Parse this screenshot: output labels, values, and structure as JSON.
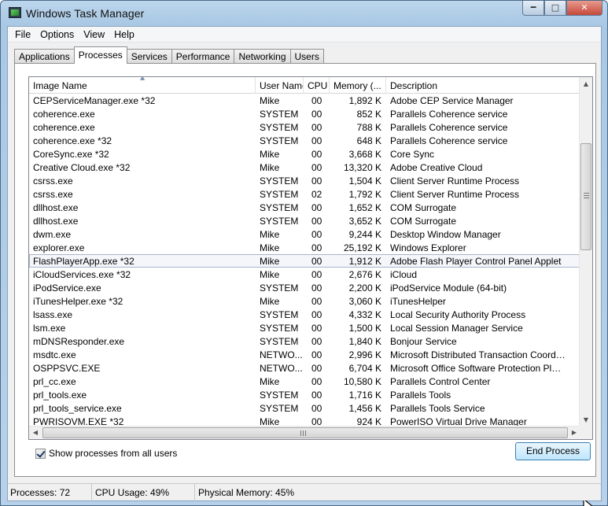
{
  "window": {
    "title": "Windows Task Manager"
  },
  "menu": [
    "File",
    "Options",
    "View",
    "Help"
  ],
  "tabs": [
    "Applications",
    "Processes",
    "Services",
    "Performance",
    "Networking",
    "Users"
  ],
  "active_tab": "Processes",
  "columns": {
    "name": "Image Name",
    "user": "User Name",
    "cpu": "CPU",
    "mem": "Memory (...",
    "desc": "Description"
  },
  "processes": [
    {
      "name": "CEPServiceManager.exe *32",
      "user": "Mike",
      "cpu": "00",
      "mem": "1,892 K",
      "desc": "Adobe CEP Service Manager"
    },
    {
      "name": "coherence.exe",
      "user": "SYSTEM",
      "cpu": "00",
      "mem": "852 K",
      "desc": "Parallels Coherence service"
    },
    {
      "name": "coherence.exe",
      "user": "SYSTEM",
      "cpu": "00",
      "mem": "788 K",
      "desc": "Parallels Coherence service"
    },
    {
      "name": "coherence.exe *32",
      "user": "SYSTEM",
      "cpu": "00",
      "mem": "648 K",
      "desc": "Parallels Coherence service"
    },
    {
      "name": "CoreSync.exe *32",
      "user": "Mike",
      "cpu": "00",
      "mem": "3,668 K",
      "desc": "Core Sync"
    },
    {
      "name": "Creative Cloud.exe *32",
      "user": "Mike",
      "cpu": "00",
      "mem": "13,320 K",
      "desc": "Adobe Creative Cloud"
    },
    {
      "name": "csrss.exe",
      "user": "SYSTEM",
      "cpu": "00",
      "mem": "1,504 K",
      "desc": "Client Server Runtime Process"
    },
    {
      "name": "csrss.exe",
      "user": "SYSTEM",
      "cpu": "02",
      "mem": "1,792 K",
      "desc": "Client Server Runtime Process"
    },
    {
      "name": "dllhost.exe",
      "user": "SYSTEM",
      "cpu": "00",
      "mem": "1,652 K",
      "desc": "COM Surrogate"
    },
    {
      "name": "dllhost.exe",
      "user": "SYSTEM",
      "cpu": "00",
      "mem": "3,652 K",
      "desc": "COM Surrogate"
    },
    {
      "name": "dwm.exe",
      "user": "Mike",
      "cpu": "00",
      "mem": "9,244 K",
      "desc": "Desktop Window Manager"
    },
    {
      "name": "explorer.exe",
      "user": "Mike",
      "cpu": "00",
      "mem": "25,192 K",
      "desc": "Windows Explorer"
    },
    {
      "name": "FlashPlayerApp.exe *32",
      "user": "Mike",
      "cpu": "00",
      "mem": "1,912 K",
      "desc": "Adobe Flash Player Control Panel Applet",
      "selected": true
    },
    {
      "name": "iCloudServices.exe *32",
      "user": "Mike",
      "cpu": "00",
      "mem": "2,676 K",
      "desc": "iCloud"
    },
    {
      "name": "iPodService.exe",
      "user": "SYSTEM",
      "cpu": "00",
      "mem": "2,200 K",
      "desc": "iPodService Module (64-bit)"
    },
    {
      "name": "iTunesHelper.exe *32",
      "user": "Mike",
      "cpu": "00",
      "mem": "3,060 K",
      "desc": "iTunesHelper"
    },
    {
      "name": "lsass.exe",
      "user": "SYSTEM",
      "cpu": "00",
      "mem": "4,332 K",
      "desc": "Local Security Authority Process"
    },
    {
      "name": "lsm.exe",
      "user": "SYSTEM",
      "cpu": "00",
      "mem": "1,500 K",
      "desc": "Local Session Manager Service"
    },
    {
      "name": "mDNSResponder.exe",
      "user": "SYSTEM",
      "cpu": "00",
      "mem": "1,840 K",
      "desc": "Bonjour Service"
    },
    {
      "name": "msdtc.exe",
      "user": "NETWO...",
      "cpu": "00",
      "mem": "2,996 K",
      "desc": "Microsoft Distributed Transaction Coordinat..."
    },
    {
      "name": "OSPPSVC.EXE",
      "user": "NETWO...",
      "cpu": "00",
      "mem": "6,704 K",
      "desc": "Microsoft Office Software Protection Platfo..."
    },
    {
      "name": "prl_cc.exe",
      "user": "Mike",
      "cpu": "00",
      "mem": "10,580 K",
      "desc": "Parallels Control Center"
    },
    {
      "name": "prl_tools.exe",
      "user": "SYSTEM",
      "cpu": "00",
      "mem": "1,716 K",
      "desc": "Parallels Tools"
    },
    {
      "name": "prl_tools_service.exe",
      "user": "SYSTEM",
      "cpu": "00",
      "mem": "1,456 K",
      "desc": "Parallels Tools Service"
    },
    {
      "name": "PWRISOVM.EXE *32",
      "user": "Mike",
      "cpu": "00",
      "mem": "924 K",
      "desc": "PowerISO Virtual Drive Manager"
    }
  ],
  "show_all_label": "Show processes from all users",
  "show_all_checked": true,
  "end_process_label": "End Process",
  "status": {
    "processes": "Processes: 72",
    "cpu": "CPU Usage: 49%",
    "memory": "Physical Memory: 45%"
  },
  "colors": {
    "selection_outline": "#a9b4c7",
    "title_gradient": "#bcd6ec",
    "close_button": "#c6493a"
  }
}
